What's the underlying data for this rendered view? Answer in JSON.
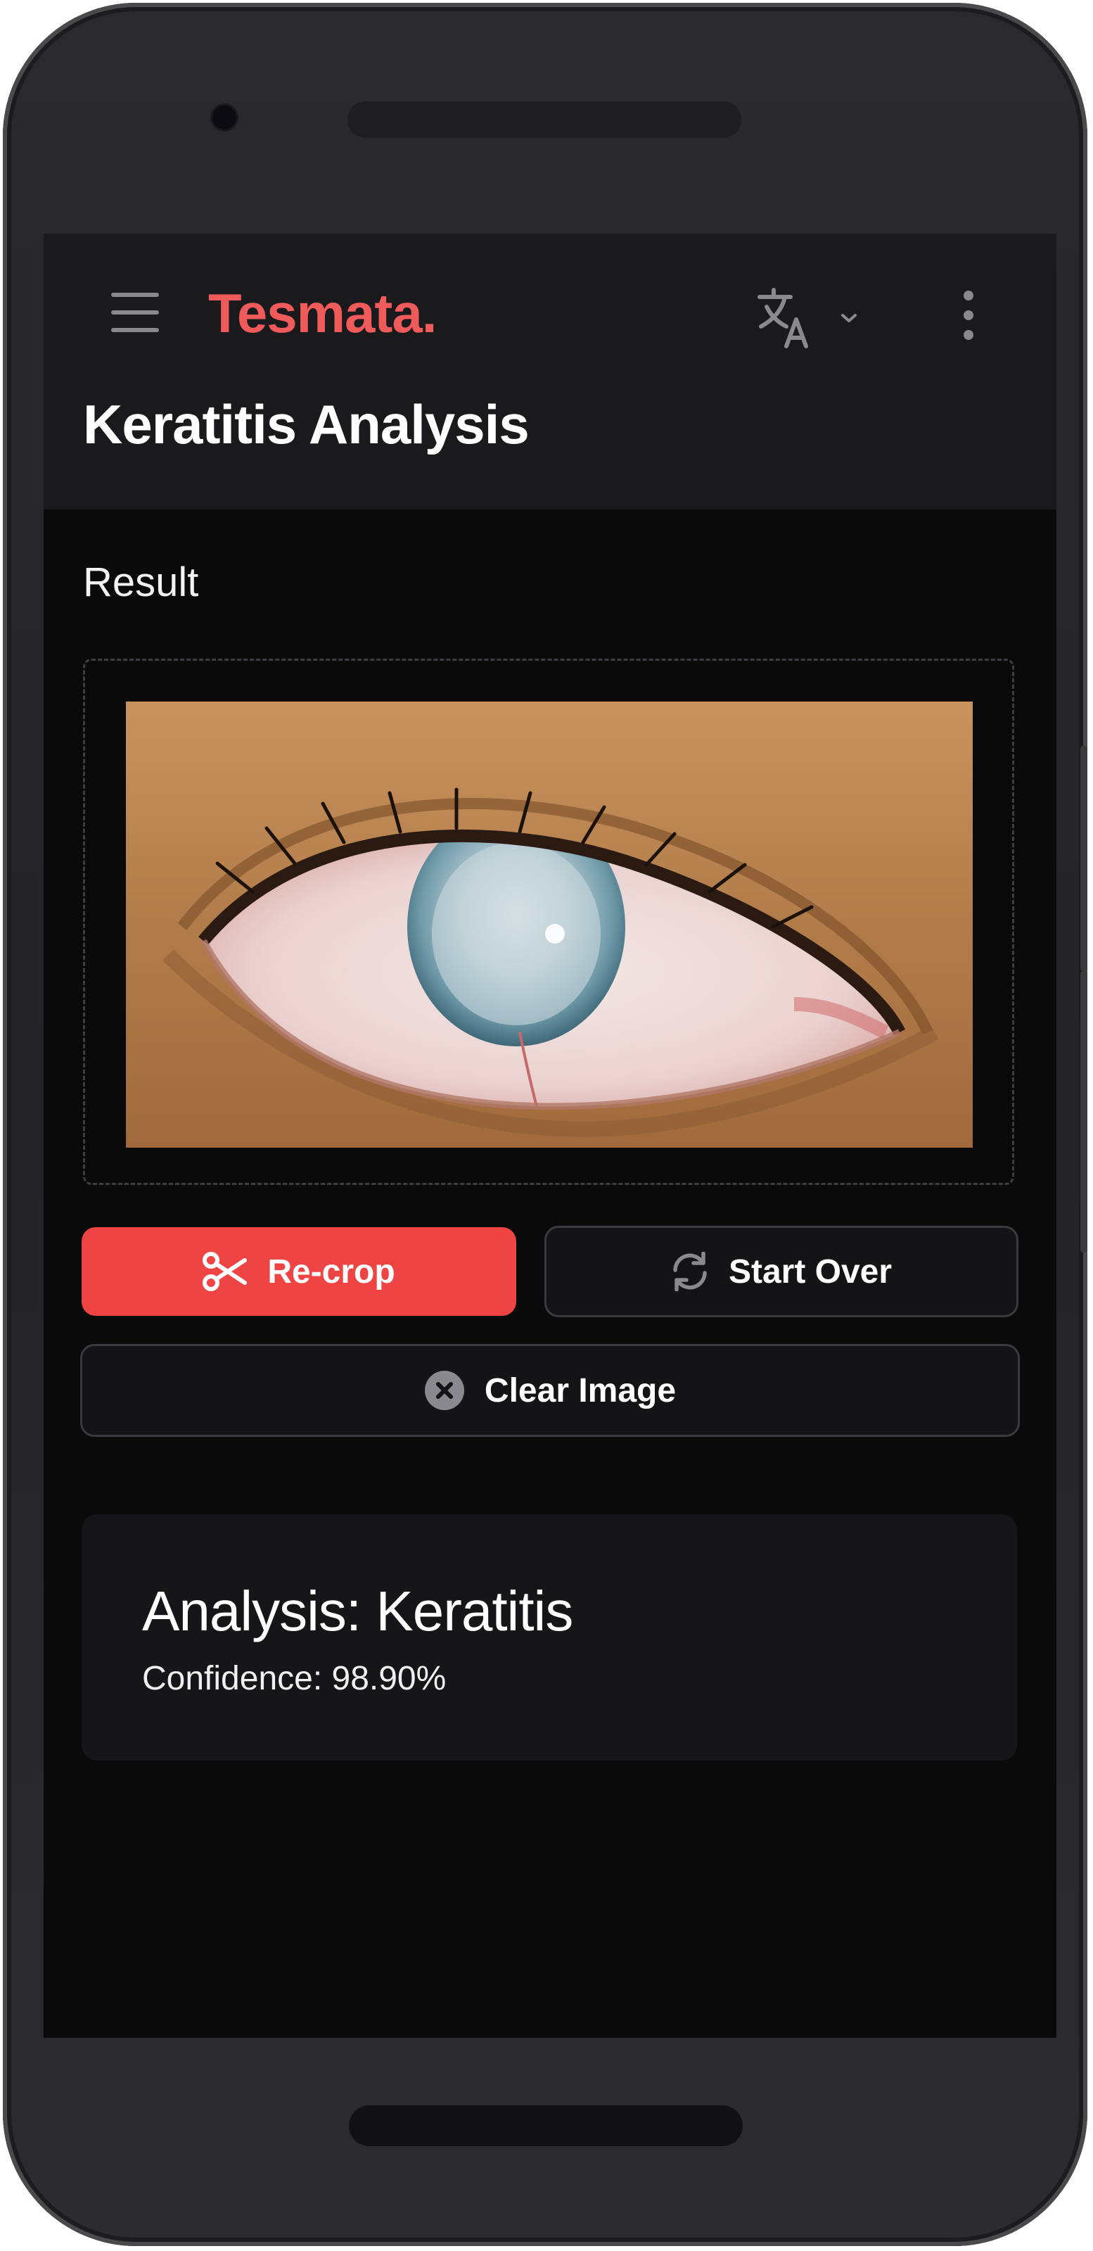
{
  "app": {
    "brand": "Tesmata.",
    "title": "Keratitis Analysis"
  },
  "header": {
    "menu_icon": "hamburger-menu-icon",
    "language_icon": "translate-icon",
    "language_caret_icon": "chevron-down-icon",
    "more_icon": "more-vertical-icon"
  },
  "result": {
    "section_label": "Result",
    "image_description": "close-up photo of an eye with a clouded cornea"
  },
  "actions": {
    "recrop_label": "Re-crop",
    "recrop_icon": "scissors-icon",
    "start_over_label": "Start Over",
    "start_over_icon": "refresh-icon",
    "clear_label": "Clear Image",
    "clear_icon": "close-circle-icon"
  },
  "analysis": {
    "title": "Analysis: Keratitis",
    "confidence": "Confidence: 98.90%"
  },
  "colors": {
    "brand": "#ef5a5a",
    "primary_button": "#ef4444",
    "appbar_bg": "#1a1a1c",
    "screen_bg": "#0a0a0b",
    "card_bg": "#161618"
  }
}
